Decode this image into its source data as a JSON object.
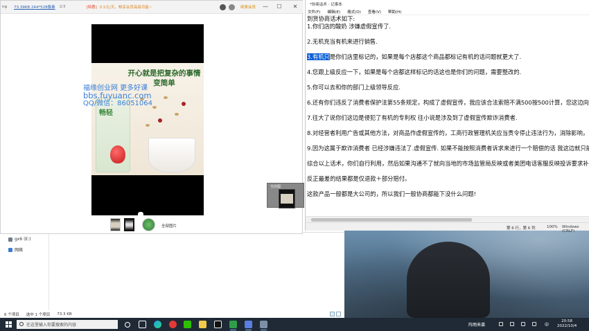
{
  "viewer": {
    "filename": "ng",
    "meta": "73.39KB  244*528像素",
    "page": "2/3",
    "ad_tag": "[特惠]",
    "ad_text": "0.5元/天，畅享会员高级功能~",
    "vip": "续费会员",
    "photo": {
      "headline": "开心就是把复杂的事情变简单",
      "brand": "畅轻",
      "watermark": [
        "福缘创业网 更多好课",
        "bbs.fuyuanc.com",
        "QQ/微信：86051064"
      ]
    },
    "all_images": "全部图片",
    "preview_caption": "当前图"
  },
  "explorer": {
    "nav": [
      {
        "label": "gx6 (E:)"
      },
      {
        "label": "网络"
      }
    ],
    "status": [
      "6 个项目",
      "选中 1 个项目",
      "73.3 KB"
    ]
  },
  "notepad": {
    "title": "*协商话术 - 记事本",
    "menu": [
      "文件(F)",
      "编辑(E)",
      "格式(O)",
      "查看(V)",
      "帮助(H)"
    ],
    "lines": [
      "到货协商话术如下:",
      "1.你们店的酸奶 涉嫌虚假宣传了.",
      "",
      "2.无机充当有机来进行销售.",
      "",
      "3.有机只是你们店里标记的，如果是每个店都这个商品都标记有机的话问题就更大了.",
      "",
      "4.您跟上级反应一下，如果是每个店都这样标记的话这也是你们的问题，需要整改的.",
      "",
      "5.你可以去和你的部门上级领导反应.",
      "",
      "6.还有你们违反了消费者保护法第55条规定，构成了虚假宣传，我应该合法索赔不满500按500计算，您这边向",
      "",
      "7.往大了说你们这边是侵犯了有机的专利权 往小说是涉及到了虚假宣传欺诈消费者.",
      "",
      "8.对经营者利用广告或其他方法，对商品作虚假宣传的，工商行政管理机关应当责令停止违法行为，消除影响，",
      "",
      "9.因为这属于欺诈消费者 已经涉嫌违法了.虚假宣传. 如果不能按照消费者诉求来进行一个赔偿的话 我这边就只能",
      "",
      "综合以上话术，你们自行利用，然后如果沟通不了就向当地的市场监管局反映或者美团电话客服反映投诉要求补",
      "",
      "反正最差的结果都是仅退款＋部分赔付。",
      "",
      "这款产品一般都是大公司的，所以我们一般协商都能下没什么问题!"
    ],
    "highlight_prefix": "3.有机只",
    "status": {
      "position": "第 6 行，第 6 列",
      "zoom": "100%",
      "encoding": "Windows (CRLF)"
    }
  },
  "taskbar": {
    "search_placeholder": "在这里输入你要搜索的内容",
    "weather": "阵雨来袭",
    "ime": "中",
    "time": "20:58",
    "date": "2022/10/4"
  }
}
